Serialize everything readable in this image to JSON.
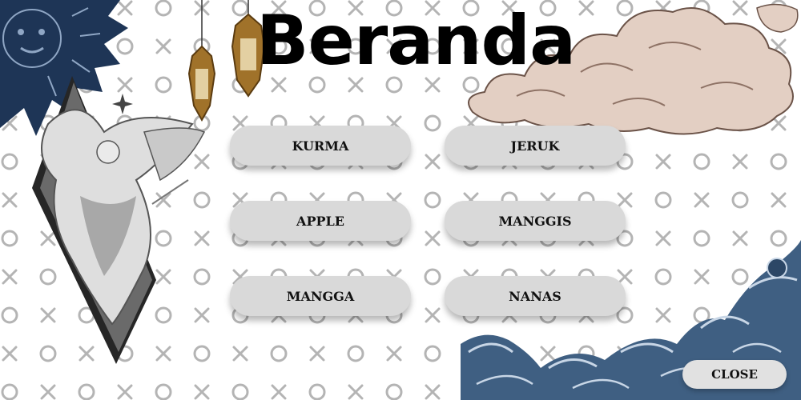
{
  "page": {
    "title": "Beranda"
  },
  "menu": {
    "buttons": [
      {
        "label": "KURMA"
      },
      {
        "label": "JERUK"
      },
      {
        "label": "APPLE"
      },
      {
        "label": "MANGGIS"
      },
      {
        "label": "MANGGA"
      },
      {
        "label": "NANAS"
      }
    ]
  },
  "footer": {
    "close_label": "CLOSE"
  },
  "decorations": {
    "icons": [
      "sun-illustration",
      "angel-illustration",
      "lantern-illustration",
      "cloud-illustration",
      "wave-illustration",
      "xo-pattern"
    ]
  },
  "colors": {
    "button": "#d9d9d9",
    "pattern": "#b4b4b4",
    "title": "#000000",
    "sun": "#1e3556",
    "wave": "#3f5f82",
    "cloud": "#e3cfc3"
  }
}
